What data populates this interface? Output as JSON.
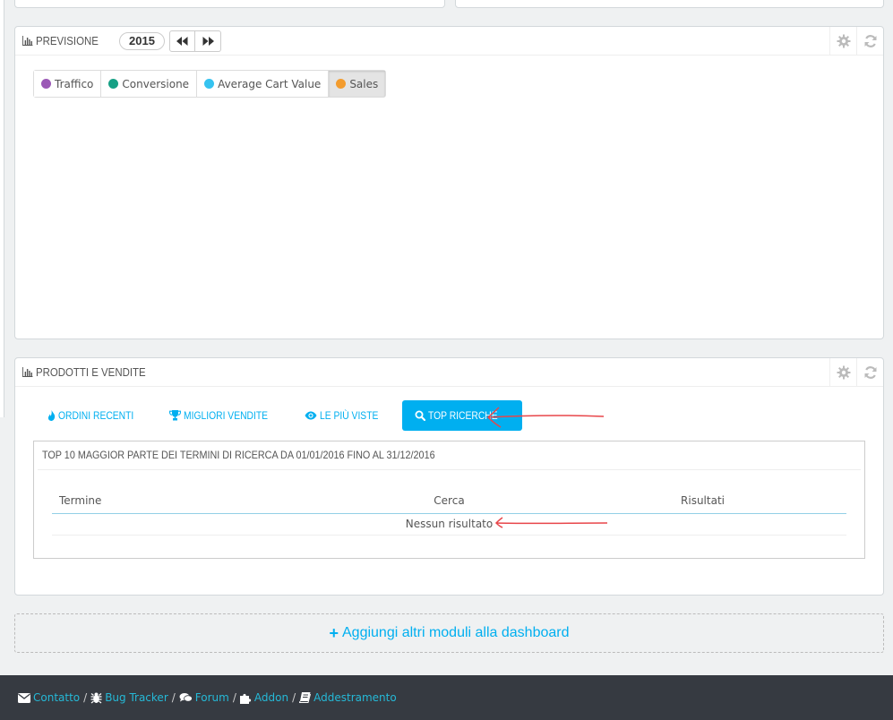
{
  "forecast": {
    "title": "PREVISIONE",
    "year": "2015",
    "legend": [
      {
        "label": "Traffico",
        "color": "#9b59b6",
        "active": false
      },
      {
        "label": "Conversione",
        "color": "#16a085",
        "active": false
      },
      {
        "label": "Average Cart Value",
        "color": "#36c3f0",
        "active": false
      },
      {
        "label": "Sales",
        "color": "#f39c2e",
        "active": true
      }
    ]
  },
  "products": {
    "title": "PRODOTTI E VENDITE",
    "tabs": [
      {
        "label": "ORDINI RECENTI",
        "icon": "fire-icon",
        "active": false
      },
      {
        "label": "MIGLIORI VENDITE",
        "icon": "trophy-icon",
        "active": false
      },
      {
        "label": "LE PIÙ VISTE",
        "icon": "eye-icon",
        "active": false
      },
      {
        "label": "TOP RICERCHE",
        "icon": "search-icon",
        "active": true
      }
    ],
    "section_title": "TOP 10 MAGGIOR PARTE DEI TERMINI DI RICERCA DA 01/01/2016 FINO AL 31/12/2016",
    "columns": [
      "Termine",
      "Cerca",
      "Risultati"
    ],
    "empty_text": "Nessun risultato"
  },
  "add_modules": "Aggiungi altri moduli alla dashboard",
  "footer": {
    "links": [
      "Contatto",
      "Bug Tracker",
      "Forum",
      "Addon",
      "Addestramento"
    ],
    "separator": "/"
  },
  "colors": {
    "accent": "#00aff0",
    "footer_bg": "#363a41",
    "footer_link": "#25b9d7",
    "annotation": "#e8464a"
  }
}
